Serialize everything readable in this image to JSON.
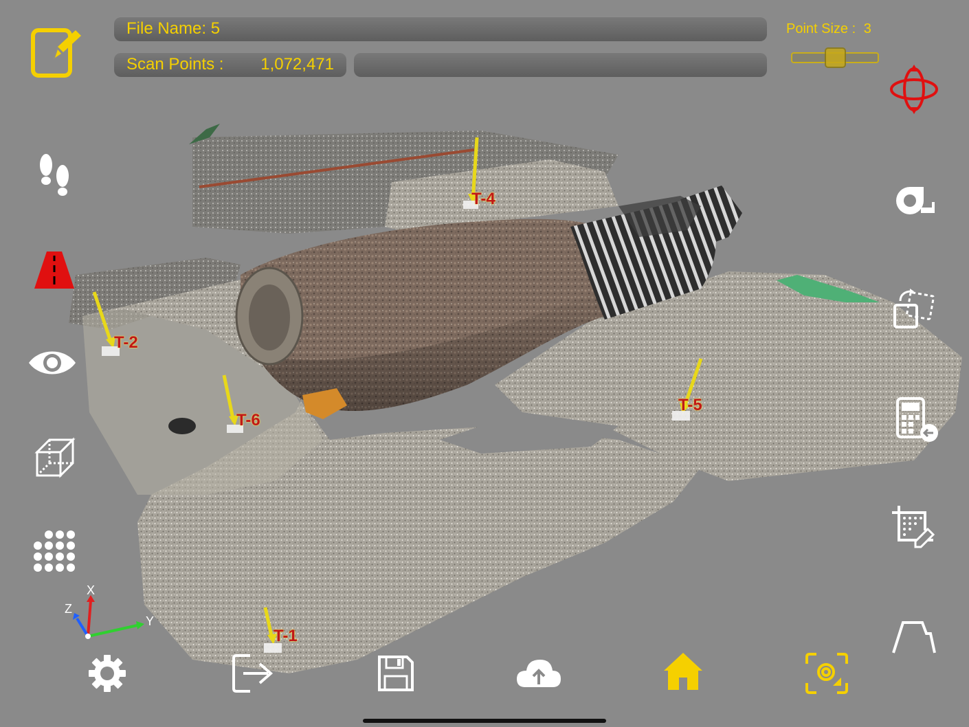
{
  "header": {
    "file_name_label": "File Name: 5",
    "scan_points_label": "Scan Points :",
    "scan_points_value": "1,072,471",
    "point_size_label": "Point Size :",
    "point_size_value": "3"
  },
  "point_size_slider": {
    "min": 1,
    "max": 5,
    "value": 3
  },
  "targets": [
    {
      "id": "T-1"
    },
    {
      "id": "T-2"
    },
    {
      "id": "T-4"
    },
    {
      "id": "T-5"
    },
    {
      "id": "T-6"
    }
  ],
  "axes": {
    "x": "X",
    "y": "Y",
    "z": "Z"
  },
  "colors": {
    "accent": "#f5d000",
    "background": "#8a8a8a",
    "warning": "#e01010",
    "axis_x": "#e02020",
    "axis_y": "#30d030",
    "axis_z": "#2060ff"
  },
  "icons": {
    "left_toolbar": [
      "edit-icon",
      "footsteps-icon",
      "road-warning-icon",
      "eye-icon",
      "cube-icon",
      "point-grid-icon"
    ],
    "right_toolbar": [
      "orbit-icon",
      "tape-measure-icon",
      "transform-icon",
      "calculator-icon",
      "crop-icon",
      "profile-icon"
    ],
    "bottom_toolbar": [
      "settings-icon",
      "exit-icon",
      "save-icon",
      "cloud-upload-icon",
      "home-icon",
      "scan-camera-icon"
    ]
  }
}
